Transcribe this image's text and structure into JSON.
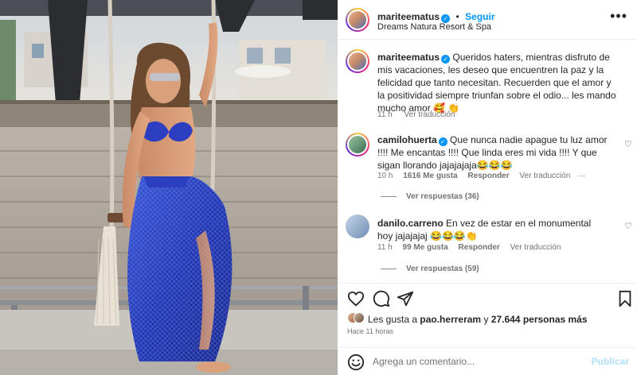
{
  "post": {
    "author": "mariteematus",
    "follow_label": "Seguir",
    "location": "Dreams Natura Resort & Spa",
    "caption_user": "mariteematus",
    "caption": "Queridos haters, mientras disfruto de mis vacaciones, les deseo que encuentren la paz y la felicidad que tanto necesitan. Recuerden que el amor y la positividad siempre triunfan sobre el odio... les mando mucho amor 🥰 👏",
    "caption_time": "11 h",
    "caption_translate": "Ver traducción"
  },
  "comments": [
    {
      "user": "camilohuerta",
      "verified": true,
      "text": "Que nunca nadie apague tu luz amor !!!! Me encantas !!!! Que linda eres mi vida !!!! Y que sigan llorando jajajajaja😂😂😂",
      "time": "10 h",
      "likes": "1616 Me gusta",
      "reply": "Responder",
      "translate": "Ver traducción",
      "more": "···",
      "replies": "Ver respuestas (36)"
    },
    {
      "user": "danilo.carreno",
      "verified": false,
      "text": "En vez de estar en el monumental hoy jajajajaj 😂😂😂👏",
      "time": "11 h",
      "likes": "99 Me gusta",
      "reply": "Responder",
      "translate": "Ver traducción",
      "replies": "Ver respuestas (59)"
    }
  ],
  "footer": {
    "likes_prefix": "Les gusta a",
    "likes_user": "pao.herreram",
    "likes_connector": "y",
    "likes_count": "27.644 personas más",
    "posted_ago": "Hace 11 horas",
    "comment_placeholder": "Agrega un comentario...",
    "publish_label": "Publicar"
  },
  "icons": {
    "verified": "verified-badge-icon",
    "more": "more-horizontal-icon",
    "like": "heart-icon",
    "comment": "comment-icon",
    "share": "send-icon",
    "save": "bookmark-icon",
    "emoji": "emoji-icon"
  },
  "colors": {
    "accent": "#0095f6",
    "muted": "#737373",
    "publish_disabled": "#b2dffc"
  }
}
